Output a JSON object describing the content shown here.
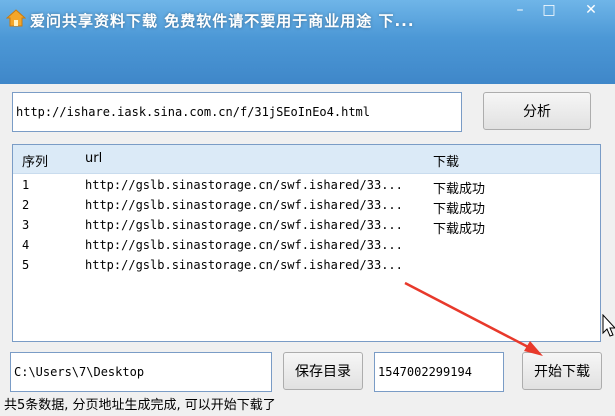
{
  "window": {
    "title": "爱问共享资料下载 免费软件请不要用于商业用途 下...",
    "min_symbol": "–",
    "max_symbol": "□",
    "close_symbol": "✕"
  },
  "url_input": {
    "value": "http://ishare.iask.sina.com.cn/f/31jSEoInEo4.html"
  },
  "analyze_button": {
    "label": "分析"
  },
  "table": {
    "columns": [
      "序列",
      "url",
      "下载"
    ],
    "rows": [
      {
        "index": "1",
        "url": "http://gslb.sinastorage.cn/swf.ishared/33...",
        "status": "下载成功"
      },
      {
        "index": "2",
        "url": "http://gslb.sinastorage.cn/swf.ishared/33...",
        "status": "下载成功"
      },
      {
        "index": "3",
        "url": "http://gslb.sinastorage.cn/swf.ishared/33...",
        "status": "下载成功"
      },
      {
        "index": "4",
        "url": "http://gslb.sinastorage.cn/swf.ishared/33...",
        "status": ""
      },
      {
        "index": "5",
        "url": "http://gslb.sinastorage.cn/swf.ishared/33...",
        "status": ""
      }
    ]
  },
  "save_dir_input": {
    "value": "C:\\Users\\7\\Desktop"
  },
  "save_dir_button": {
    "label": "保存目录"
  },
  "id_input": {
    "value": "1547002299194"
  },
  "start_button": {
    "label": "开始下载"
  },
  "status_bar": {
    "text": "共5条数据, 分页地址生成完成, 可以开始下载了"
  },
  "colors": {
    "titlebar": "#4c98d6",
    "arrow": "#e8392b",
    "border": "#7a9cc6"
  }
}
